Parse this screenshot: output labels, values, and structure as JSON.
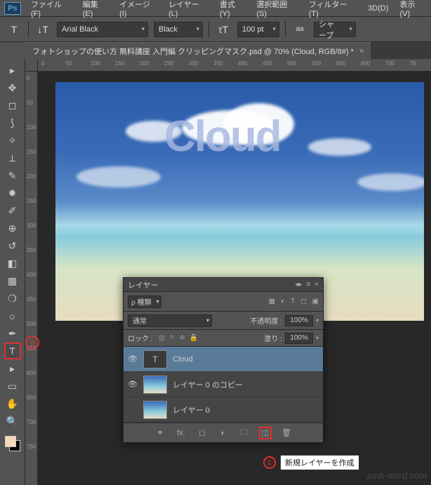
{
  "menu": [
    "ファイル(F)",
    "編集(E)",
    "イメージ(I)",
    "レイヤー(L)",
    "書式(Y)",
    "選択範囲(S)",
    "フィルター(T)",
    "3D(D)",
    "表示(V)"
  ],
  "options": {
    "font_family": "Arial Black",
    "font_style": "Black",
    "font_size": "100 pt",
    "aa": "シャープ"
  },
  "tab": {
    "title": "フォトショップの使い方 無料講座 入門編 クリッピングマスク.psd @ 70% (Cloud, RGB/8#) *",
    "close": "×"
  },
  "ruler_h": [
    "0",
    "50",
    "100",
    "150",
    "200",
    "250",
    "300",
    "350",
    "400",
    "450",
    "500",
    "550",
    "600",
    "650",
    "700",
    "75"
  ],
  "ruler_v": [
    "0",
    "50",
    "100",
    "150",
    "200",
    "250",
    "300",
    "350",
    "400",
    "450",
    "500",
    "550",
    "600",
    "650",
    "700",
    "750"
  ],
  "cloud_text": "Cloud",
  "layers_panel": {
    "title": "レイヤー",
    "filter_label": "ρ 種類",
    "blend_mode": "通常",
    "opacity_label": "不透明度 :",
    "opacity_value": "100%",
    "lock_label": "ロック :",
    "fill_label": "塗り :",
    "fill_value": "100%",
    "layers": [
      {
        "name": "Cloud",
        "type": "text",
        "visible": true
      },
      {
        "name": "レイヤー 0 のコピー",
        "type": "img",
        "visible": true
      },
      {
        "name": "レイヤー 0",
        "type": "img",
        "visible": false
      }
    ],
    "new_layer_tooltip": "新規レイヤーを作成"
  },
  "annotation_numbers": {
    "one": "①",
    "two": "②"
  },
  "watermark": "junk-word.com",
  "aa_label": "aa",
  "text_icon": "T",
  "orientation_icon": "↓T"
}
